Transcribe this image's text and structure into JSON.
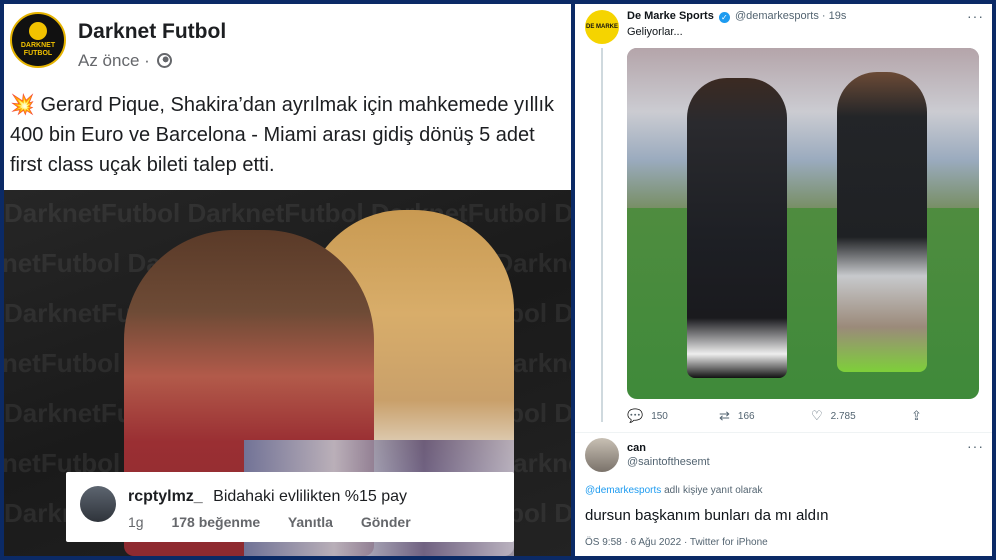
{
  "facebook_post": {
    "page_name": "Darknet Futbol",
    "avatar_text": "DARKNET FUTBOL",
    "time": "Az önce",
    "separator": "·",
    "emoji": "💥",
    "text": "Gerard Pique, Shakira’dan ayrılmak için mahkemede yıllık 400 bin Euro ve Barcelona - Miami arası gidiş dönüş 5 adet first class uçak bileti talep etti.",
    "watermark": "DarknetFutbol DarknetFutbol DarknetFutbol DarknetFutbol",
    "comment": {
      "username": "rcptylmz_",
      "text": "Bidahaki evlilikten %15 pay",
      "time": "1g",
      "likes": "178 beğenme",
      "reply": "Yanıtla",
      "send": "Gönder"
    }
  },
  "tweet": {
    "avatar_text": "DE MARKE",
    "name": "De Marke Sports",
    "handle": "@demarkesports",
    "separator": "·",
    "time": "19s",
    "more": "···",
    "text": "Geliyorlar...",
    "replies": "150",
    "retweets": "166",
    "likes": "2.785",
    "icons": [
      "reply-icon",
      "retweet-icon",
      "heart-icon",
      "share-icon"
    ]
  },
  "reply": {
    "name": "can",
    "handle": "@saintofthesemt",
    "more": "···",
    "reply_mention": "@demarkesports",
    "reply_suffix": " adlı kişiye yanıt olarak",
    "text": "dursun başkanım bunları da mı aldın",
    "meta": "ÖS 9:58 · 6 Ağu 2022 · Twitter for iPhone"
  },
  "colors": {
    "frame": "#0b2a66",
    "twitter_blue": "#1d9bf0",
    "brand_yellow": "#f5d400"
  }
}
